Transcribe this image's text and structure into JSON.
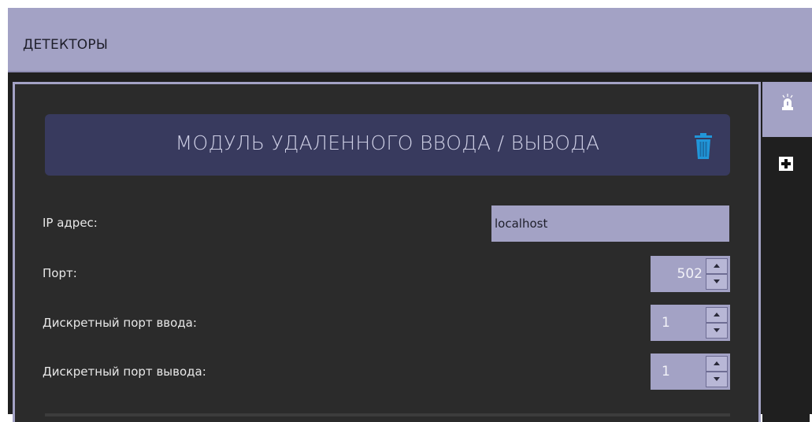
{
  "header": {
    "title": "ДЕТЕКТОРЫ"
  },
  "module": {
    "title": "МОДУЛЬ УДАЛЕННОГО ВВОДА / ВЫВОДА",
    "delete_icon": "trash-icon",
    "accent": "#2196d9"
  },
  "fields": {
    "ip": {
      "label": "IP адрес:",
      "value": "localhost"
    },
    "port": {
      "label": "Порт:",
      "value": "502"
    },
    "input_port": {
      "label": "Дискретный порт ввода:",
      "value": "1"
    },
    "output_port": {
      "label": "Дискретный порт вывода:",
      "value": "1"
    }
  },
  "side_tabs": {
    "active_icon": "alarm-beacon-icon",
    "add_icon": "plus-icon"
  },
  "colors": {
    "header_bg": "#a3a2c5",
    "panel_bg": "#2b2b2b",
    "card_bg": "#383a5e"
  }
}
